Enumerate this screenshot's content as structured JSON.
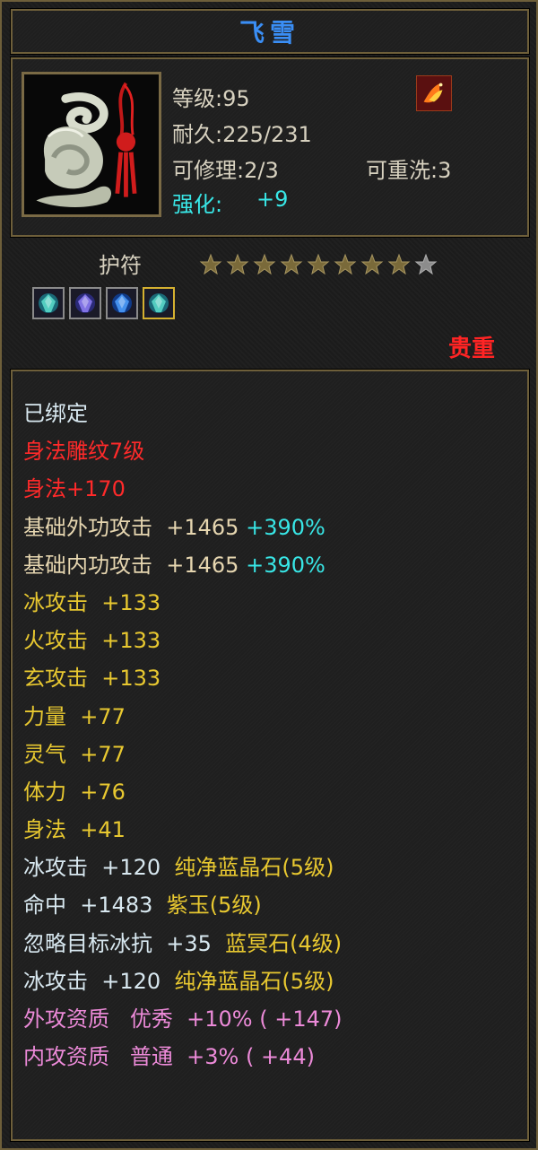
{
  "title": "飞雪",
  "header": {
    "icon": "jade-amulet-icon",
    "level": "等级:95",
    "durability": "耐久:225/231",
    "repairable": "可修理:2/3",
    "rewashable": "可重洗:3",
    "enhance_label": "强化:",
    "enhance_value": "+9",
    "badge": "phoenix-badge-icon"
  },
  "item_type": "护符",
  "stars": {
    "filled": 8,
    "total": 9
  },
  "gems": [
    "cyan-gem-icon",
    "purple-gem-icon",
    "blue-gem-icon",
    "cyan-gem-icon"
  ],
  "rarity": "贵重",
  "colors": {
    "accent": "#3a8ef5",
    "rare": "#ff2424",
    "cyan": "#38e6e6",
    "yellow": "#e8c830",
    "pink": "#ec8ad8"
  },
  "attributes": [
    {
      "parts": [
        {
          "text": "已绑定",
          "color": "white"
        }
      ]
    },
    {
      "parts": [
        {
          "text": "身法雕纹7级",
          "color": "red"
        }
      ]
    },
    {
      "parts": [
        {
          "text": "身法+170",
          "color": "red"
        }
      ]
    },
    {
      "parts": [
        {
          "text": "基础外功攻击  +1465 ",
          "color": "tan"
        },
        {
          "text": "+390%",
          "color": "cyan"
        }
      ]
    },
    {
      "parts": [
        {
          "text": "基础内功攻击  +1465 ",
          "color": "tan"
        },
        {
          "text": "+390%",
          "color": "cyan"
        }
      ]
    },
    {
      "parts": [
        {
          "text": "冰攻击  +133",
          "color": "yellow"
        }
      ]
    },
    {
      "parts": [
        {
          "text": "火攻击  +133",
          "color": "yellow"
        }
      ]
    },
    {
      "parts": [
        {
          "text": "玄攻击  +133",
          "color": "yellow"
        }
      ]
    },
    {
      "parts": [
        {
          "text": "力量  +77",
          "color": "yellow"
        }
      ]
    },
    {
      "parts": [
        {
          "text": "灵气  +77",
          "color": "yellow"
        }
      ]
    },
    {
      "parts": [
        {
          "text": "体力  +76",
          "color": "yellow"
        }
      ]
    },
    {
      "parts": [
        {
          "text": "身法  +41",
          "color": "yellow"
        }
      ]
    },
    {
      "parts": [
        {
          "text": "冰攻击  +120  ",
          "color": "white"
        },
        {
          "text": "纯净蓝晶石(5级)",
          "color": "yellow"
        }
      ]
    },
    {
      "parts": [
        {
          "text": "命中  +1483  ",
          "color": "white"
        },
        {
          "text": "紫玉(5级)",
          "color": "yellow"
        }
      ]
    },
    {
      "parts": [
        {
          "text": "忽略目标冰抗  +35  ",
          "color": "white"
        },
        {
          "text": "蓝冥石(4级)",
          "color": "yellow"
        }
      ]
    },
    {
      "parts": [
        {
          "text": "冰攻击  +120  ",
          "color": "white"
        },
        {
          "text": "纯净蓝晶石(5级)",
          "color": "yellow"
        }
      ]
    },
    {
      "parts": [
        {
          "text": "外攻资质   优秀  +10% ( +147)",
          "color": "pink"
        }
      ]
    },
    {
      "parts": [
        {
          "text": "内攻资质   普通  +3% ( +44)",
          "color": "pink"
        }
      ]
    }
  ]
}
